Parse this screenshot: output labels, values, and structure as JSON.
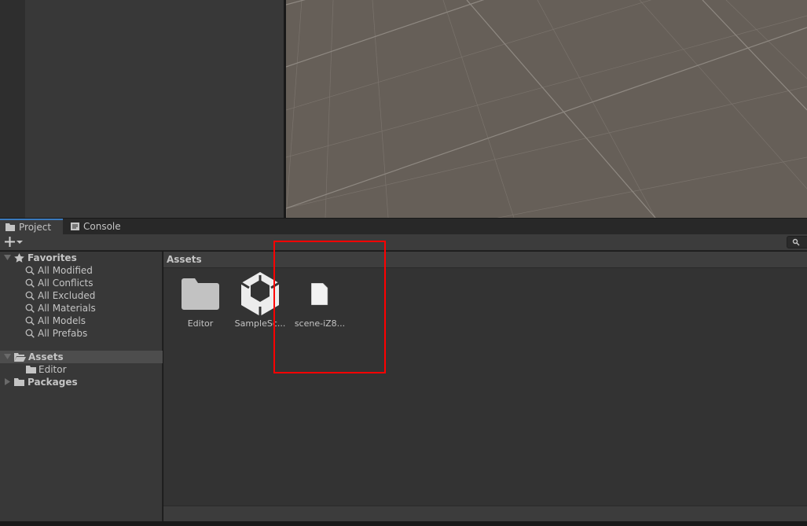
{
  "tabs": [
    {
      "label": "Project",
      "icon": "folder-icon",
      "active": true
    },
    {
      "label": "Console",
      "icon": "console-icon",
      "active": false
    }
  ],
  "toolbar": {
    "add_icon": "plus-icon",
    "search_icon": "search-icon"
  },
  "tree": {
    "favorites": {
      "label": "Favorites",
      "items": [
        "All Modified",
        "All Conflicts",
        "All Excluded",
        "All Materials",
        "All Models",
        "All Prefabs"
      ]
    },
    "assets": {
      "label": "Assets",
      "children": [
        "Editor"
      ]
    },
    "packages": {
      "label": "Packages"
    }
  },
  "pane": {
    "title": "Assets",
    "items": [
      {
        "label": "Editor",
        "icon": "folder-icon"
      },
      {
        "label": "SampleSc...",
        "icon": "unity-scene-icon"
      },
      {
        "label": "scene-iZ8...",
        "icon": "file-icon"
      }
    ]
  },
  "colors": {
    "highlight": "#ff0000",
    "accent": "#3a79bb"
  }
}
